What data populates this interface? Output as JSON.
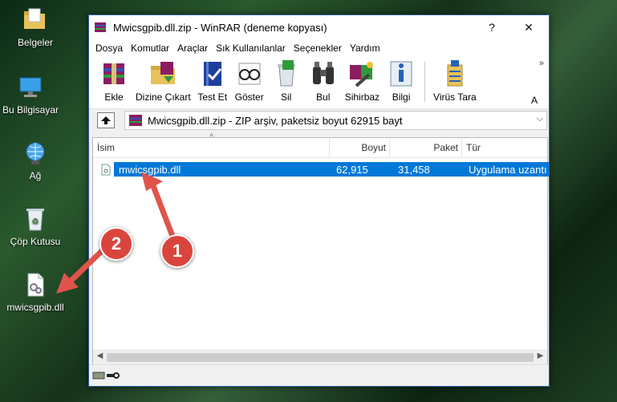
{
  "desktop": {
    "icons": [
      {
        "label": "Belgeler"
      },
      {
        "label": "Bu Bilgisayar"
      },
      {
        "label": "Ağ"
      },
      {
        "label": "Çöp Kutusu"
      },
      {
        "label": "mwicsgpib.dll"
      }
    ]
  },
  "window": {
    "title": "Mwicsgpib.dll.zip - WinRAR (deneme kopyası)",
    "help_btn": "?",
    "close_btn": "✕"
  },
  "menu": [
    "Dosya",
    "Komutlar",
    "Araçlar",
    "Sık Kullanılanlar",
    "Seçenekler",
    "Yardım"
  ],
  "toolbar": {
    "tools": [
      "Ekle",
      "Dizine Çıkart",
      "Test Et",
      "Göster",
      "Sil",
      "Bul",
      "Sihirbaz",
      "Bilgi",
      "Virüs Tara"
    ],
    "more": "»",
    "partial": "A"
  },
  "address": {
    "text": "Mwicsgpib.dll.zip - ZIP arşiv, paketsiz boyut 62915 bayt",
    "chevron": "⌵"
  },
  "list": {
    "columns": [
      "İsim",
      "Boyut",
      "Paket",
      "Tür"
    ],
    "sort_arrow": "^",
    "rows": [
      {
        "name": "mwicsgpib.dll",
        "size": "62,915",
        "packed": "31,458",
        "type": "Uygulama uzantı"
      }
    ]
  },
  "badges": [
    "1",
    "2"
  ],
  "colors": {
    "selection": "#0078d7",
    "badge": "#d9453d",
    "arrow": "#e0544b"
  }
}
